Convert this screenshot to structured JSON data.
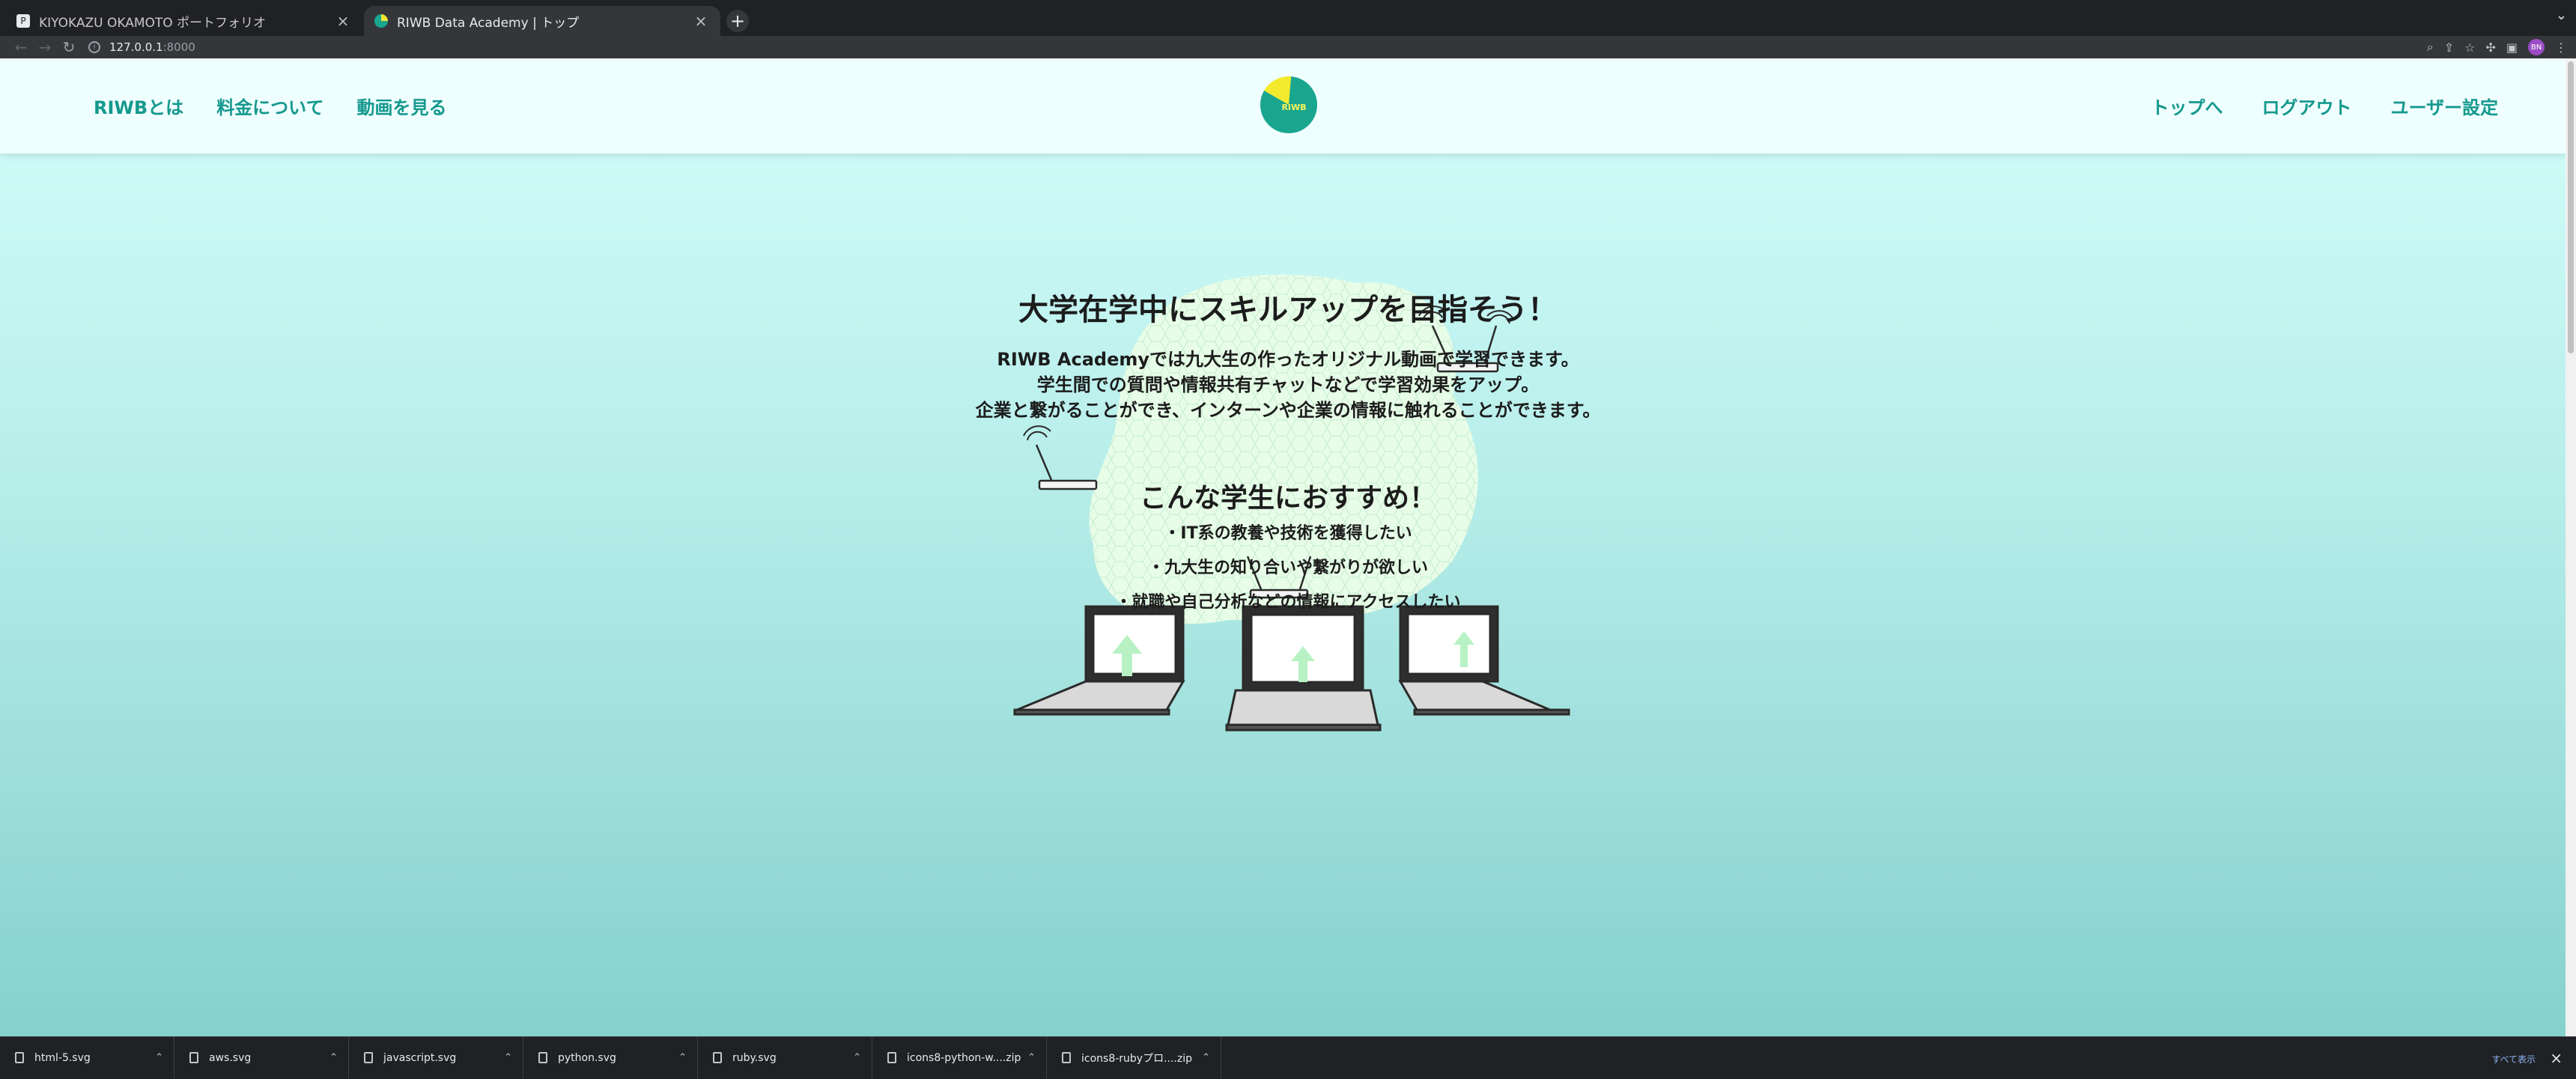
{
  "browser": {
    "tabs": [
      {
        "title": "KIYOKAZU OKAMOTO ポートフォリオ",
        "active": false
      },
      {
        "title": "RIWB Data Academy | トップ",
        "active": true
      }
    ],
    "new_tab_label": "+",
    "url_host": "127.0.0.1",
    "url_port": ":8000",
    "profile_initials": "BN"
  },
  "header": {
    "nav_left": [
      "RIWBとは",
      "料金について",
      "動画を見る"
    ],
    "logo_text": "RIWB",
    "nav_right": [
      "トップへ",
      "ログアウト",
      "ユーザー設定"
    ]
  },
  "hero": {
    "title": "大学在学中にスキルアップを目指そう！",
    "lines": [
      "RIWB Academyでは九大生の作ったオリジナル動画で学習できます。",
      "学生間での質問や情報共有チャットなどで学習効果をアップ。",
      "企業と繋がることができ、インターンや企業の情報に触れることができます。"
    ]
  },
  "recommend": {
    "title": "こんな学生におすすめ！",
    "items": [
      "・IT系の教養や技術を獲得したい",
      "・九大生の知り合いや繋がりが欲しい",
      "・就職や自己分析などの情報にアクセスしたい"
    ]
  },
  "downloads": {
    "items": [
      "html-5.svg",
      "aws.svg",
      "javascript.svg",
      "python.svg",
      "ruby.svg",
      "icons8-python-w....zip",
      "icons8-rubyプロ....zip"
    ],
    "show_all": "すべて表示"
  },
  "colors": {
    "accent": "#14998e",
    "logo_yellow": "#f3ea2d",
    "logo_teal": "#1aa58f",
    "bg_top": "#d4fefc",
    "bg_bottom": "#86d1cd"
  }
}
